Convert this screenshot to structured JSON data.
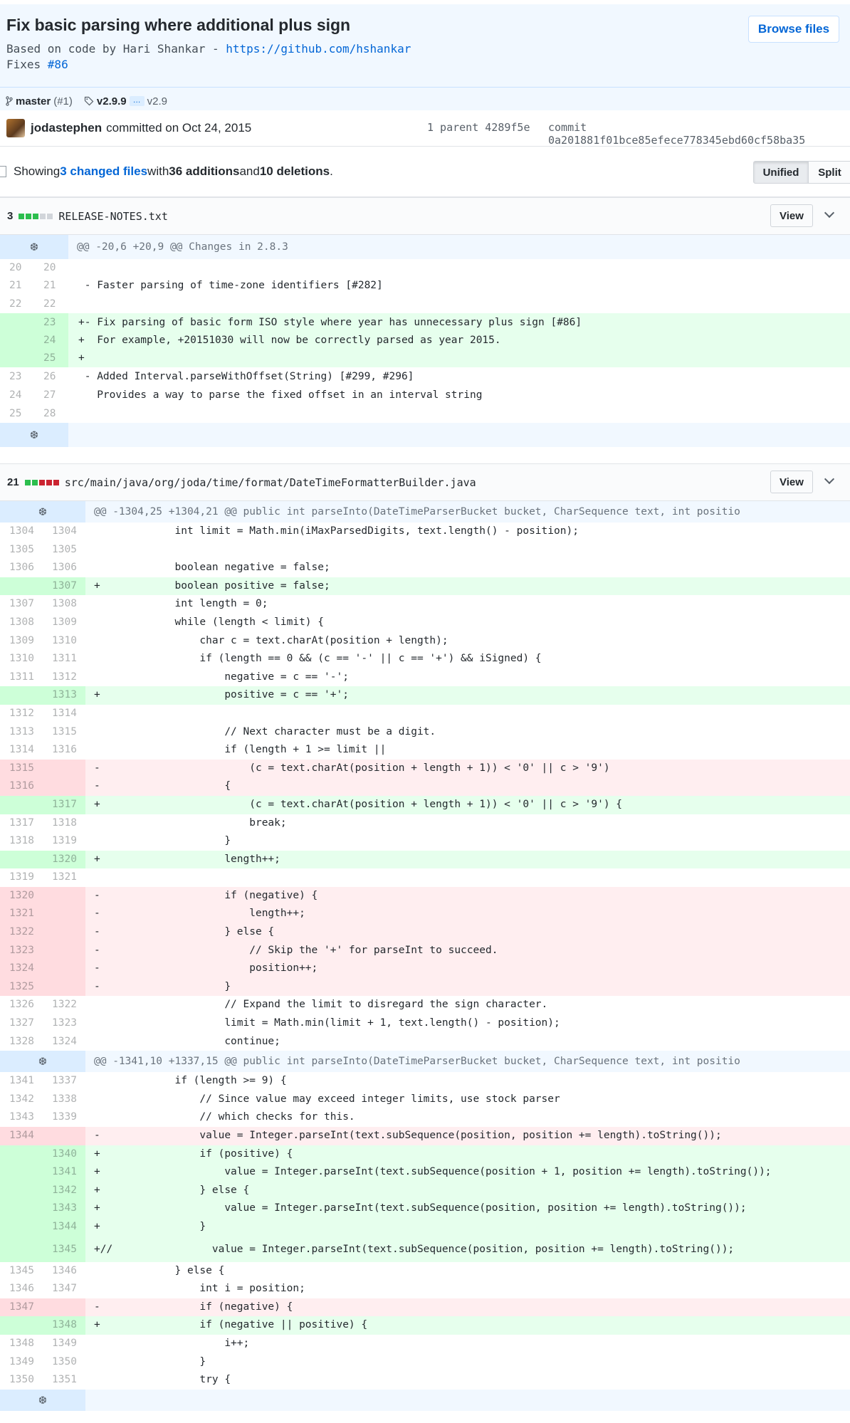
{
  "commit": {
    "title": "Fix basic parsing where additional plus sign",
    "desc_prefix": "Based on code by Hari Shankar - ",
    "desc_link": "https://github.com/hshankar",
    "fixes_label": "Fixes ",
    "fixes_issue": "#86",
    "browse_label": "Browse files",
    "branch": "master",
    "branch_pr": "(#1)",
    "tag_first": "v2.9.9",
    "tag_ellipsis": "…",
    "tag_last": "v2.9",
    "author": "jodastephen",
    "committed_text": "committed on Oct 24, 2015",
    "parent_text": "1 parent 4289f5e",
    "commit_text": "commit 0a201881f01bce85efece778345ebd60cf58ba35"
  },
  "toolbar": {
    "showing": "Showing ",
    "changed_files": "3 changed files",
    "with": " with ",
    "additions": "36 additions",
    "and": " and ",
    "deletions": "10 deletions",
    "period": ".",
    "unified": "Unified",
    "split": "Split"
  },
  "files": [
    {
      "count": "3",
      "path": "RELEASE-NOTES.txt",
      "view": "View",
      "hunk": "@@ -20,6 +20,9 @@ Changes in 2.8.3",
      "lines": [
        {
          "t": "ctx",
          "o": "20",
          "n": "20",
          "c": " "
        },
        {
          "t": "ctx",
          "o": "21",
          "n": "21",
          "c": " - Faster parsing of time-zone identifiers [#282]"
        },
        {
          "t": "ctx",
          "o": "22",
          "n": "22",
          "c": " "
        },
        {
          "t": "add",
          "o": "",
          "n": "23",
          "c": "+- Fix parsing of basic form ISO style where year has unnecessary plus sign [#86]"
        },
        {
          "t": "add",
          "o": "",
          "n": "24",
          "c": "+  For example, +20151030 will now be correctly parsed as year 2015."
        },
        {
          "t": "add",
          "o": "",
          "n": "25",
          "c": "+"
        },
        {
          "t": "ctx",
          "o": "23",
          "n": "26",
          "c": " - Added Interval.parseWithOffset(String) [#299, #296]"
        },
        {
          "t": "ctx",
          "o": "24",
          "n": "27",
          "c": "   Provides a way to parse the fixed offset in an interval string"
        },
        {
          "t": "ctx",
          "o": "25",
          "n": "28",
          "c": " "
        }
      ]
    },
    {
      "count": "21",
      "path": "src/main/java/org/joda/time/format/DateTimeFormatterBuilder.java",
      "view": "View",
      "hunk": "@@ -1304,25 +1304,21 @@ public int parseInto(DateTimeParserBucket bucket, CharSequence text, int positio",
      "hunk2": "@@ -1341,10 +1337,15 @@ public int parseInto(DateTimeParserBucket bucket, CharSequence text, int positio"
    }
  ],
  "java_lines_a": [
    {
      "t": "ctx",
      "o": "1304",
      "n": "1304",
      "c": "             int limit = Math.min(iMaxParsedDigits, text.length() - position);"
    },
    {
      "t": "ctx",
      "o": "1305",
      "n": "1305",
      "c": ""
    },
    {
      "t": "ctx",
      "o": "1306",
      "n": "1306",
      "c": "             boolean negative = false;"
    },
    {
      "t": "add",
      "o": "",
      "n": "1307",
      "c": "+            boolean positive = false;"
    },
    {
      "t": "ctx",
      "o": "1307",
      "n": "1308",
      "c": "             int length = 0;"
    },
    {
      "t": "ctx",
      "o": "1308",
      "n": "1309",
      "c": "             while (length < limit) {"
    },
    {
      "t": "ctx",
      "o": "1309",
      "n": "1310",
      "c": "                 char c = text.charAt(position + length);"
    },
    {
      "t": "ctx",
      "o": "1310",
      "n": "1311",
      "c": "                 if (length == 0 && (c == '-' || c == '+') && iSigned) {"
    },
    {
      "t": "ctx",
      "o": "1311",
      "n": "1312",
      "c": "                     negative = c == '-';"
    },
    {
      "t": "add",
      "o": "",
      "n": "1313",
      "c": "+                    positive = c == '+';"
    },
    {
      "t": "ctx",
      "o": "1312",
      "n": "1314",
      "c": ""
    },
    {
      "t": "ctx",
      "o": "1313",
      "n": "1315",
      "c": "                     // Next character must be a digit."
    },
    {
      "t": "ctx",
      "o": "1314",
      "n": "1316",
      "c": "                     if (length + 1 >= limit ||"
    },
    {
      "t": "del",
      "o": "1315",
      "n": "",
      "c": "-                        (c = text.charAt(position + length + 1)) < '0' || c > '9')"
    },
    {
      "t": "del",
      "o": "1316",
      "n": "",
      "c": "-                    {"
    },
    {
      "t": "add",
      "o": "",
      "n": "1317",
      "c": "+                        (c = text.charAt(position + length + 1)) < '0' || c > '9') {"
    },
    {
      "t": "ctx",
      "o": "1317",
      "n": "1318",
      "c": "                         break;"
    },
    {
      "t": "ctx",
      "o": "1318",
      "n": "1319",
      "c": "                     }"
    },
    {
      "t": "add",
      "o": "",
      "n": "1320",
      "c": "+                    length++;"
    },
    {
      "t": "ctx",
      "o": "1319",
      "n": "1321",
      "c": ""
    },
    {
      "t": "del",
      "o": "1320",
      "n": "",
      "c": "-                    if (negative) {"
    },
    {
      "t": "del",
      "o": "1321",
      "n": "",
      "c": "-                        length++;"
    },
    {
      "t": "del",
      "o": "1322",
      "n": "",
      "c": "-                    } else {"
    },
    {
      "t": "del",
      "o": "1323",
      "n": "",
      "c": "-                        // Skip the '+' for parseInt to succeed."
    },
    {
      "t": "del",
      "o": "1324",
      "n": "",
      "c": "-                        position++;"
    },
    {
      "t": "del",
      "o": "1325",
      "n": "",
      "c": "-                    }"
    },
    {
      "t": "ctx",
      "o": "1326",
      "n": "1322",
      "c": "                     // Expand the limit to disregard the sign character."
    },
    {
      "t": "ctx",
      "o": "1327",
      "n": "1323",
      "c": "                     limit = Math.min(limit + 1, text.length() - position);"
    },
    {
      "t": "ctx",
      "o": "1328",
      "n": "1324",
      "c": "                     continue;"
    }
  ],
  "java_lines_b": [
    {
      "t": "ctx",
      "o": "1341",
      "n": "1337",
      "c": "             if (length >= 9) {"
    },
    {
      "t": "ctx",
      "o": "1342",
      "n": "1338",
      "c": "                 // Since value may exceed integer limits, use stock parser"
    },
    {
      "t": "ctx",
      "o": "1343",
      "n": "1339",
      "c": "                 // which checks for this."
    },
    {
      "t": "del",
      "o": "1344",
      "n": "",
      "c": "-                value = Integer.parseInt(text.subSequence(position, position += length).toString());"
    },
    {
      "t": "add",
      "o": "",
      "n": "1340",
      "c": "+                if (positive) {"
    },
    {
      "t": "add",
      "o": "",
      "n": "1341",
      "c": "+                    value = Integer.parseInt(text.subSequence(position + 1, position += length).toString());"
    },
    {
      "t": "add",
      "o": "",
      "n": "1342",
      "c": "+                } else {"
    },
    {
      "t": "add",
      "o": "",
      "n": "1343",
      "c": "+                    value = Integer.parseInt(text.subSequence(position, position += length).toString());"
    },
    {
      "t": "add",
      "o": "",
      "n": "1344",
      "c": "+                }"
    },
    {
      "t": "add2",
      "o": "",
      "n": "1345",
      "c": "+//                value = Integer.parseInt(text.subSequence(position, position += length).toString());"
    },
    {
      "t": "ctx",
      "o": "1345",
      "n": "1346",
      "c": "             } else {"
    },
    {
      "t": "ctx",
      "o": "1346",
      "n": "1347",
      "c": "                 int i = position;"
    },
    {
      "t": "del",
      "o": "1347",
      "n": "",
      "c": "-                if (negative) {"
    },
    {
      "t": "add",
      "o": "",
      "n": "1348",
      "c": "+                if (negative || positive) {"
    },
    {
      "t": "ctx",
      "o": "1348",
      "n": "1349",
      "c": "                     i++;"
    },
    {
      "t": "ctx",
      "o": "1349",
      "n": "1350",
      "c": "                 }"
    },
    {
      "t": "ctx",
      "o": "1350",
      "n": "1351",
      "c": "                 try {"
    }
  ],
  "icons": {
    "expand": "❆",
    "branch": "branch-icon",
    "tag": "tag-icon"
  }
}
